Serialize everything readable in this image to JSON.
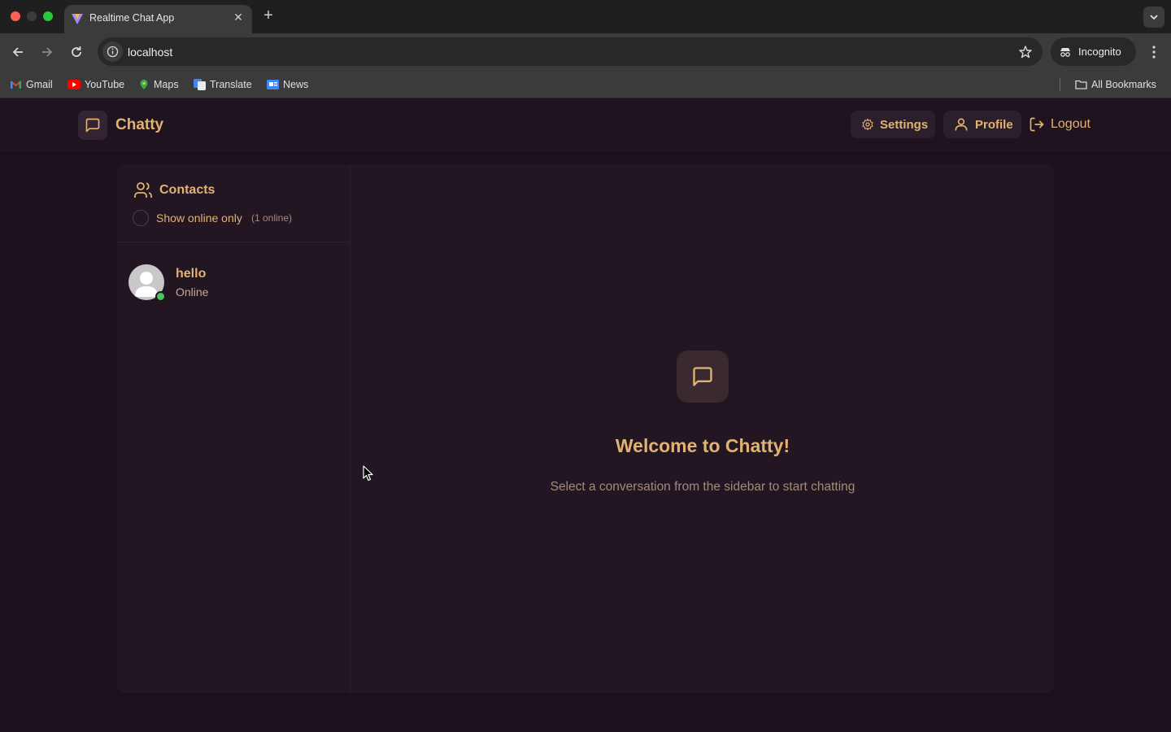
{
  "browser": {
    "tab_title": "Realtime Chat App",
    "url": "localhost",
    "incognito_label": "Incognito",
    "bookmarks": [
      "Gmail",
      "YouTube",
      "Maps",
      "Translate",
      "News"
    ],
    "all_bookmarks_label": "All Bookmarks"
  },
  "app": {
    "brand": "Chatty",
    "nav": {
      "settings": "Settings",
      "profile": "Profile",
      "logout": "Logout"
    },
    "sidebar": {
      "title": "Contacts",
      "online_filter_label": "Show online only",
      "online_count": "(1 online)",
      "contacts": [
        {
          "name": "hello",
          "status": "Online"
        }
      ]
    },
    "welcome": {
      "title": "Welcome to Chatty!",
      "subtitle": "Select a conversation from the sidebar to start chatting"
    },
    "accent_color": "#e2b270",
    "online_color": "#4cc35c"
  }
}
